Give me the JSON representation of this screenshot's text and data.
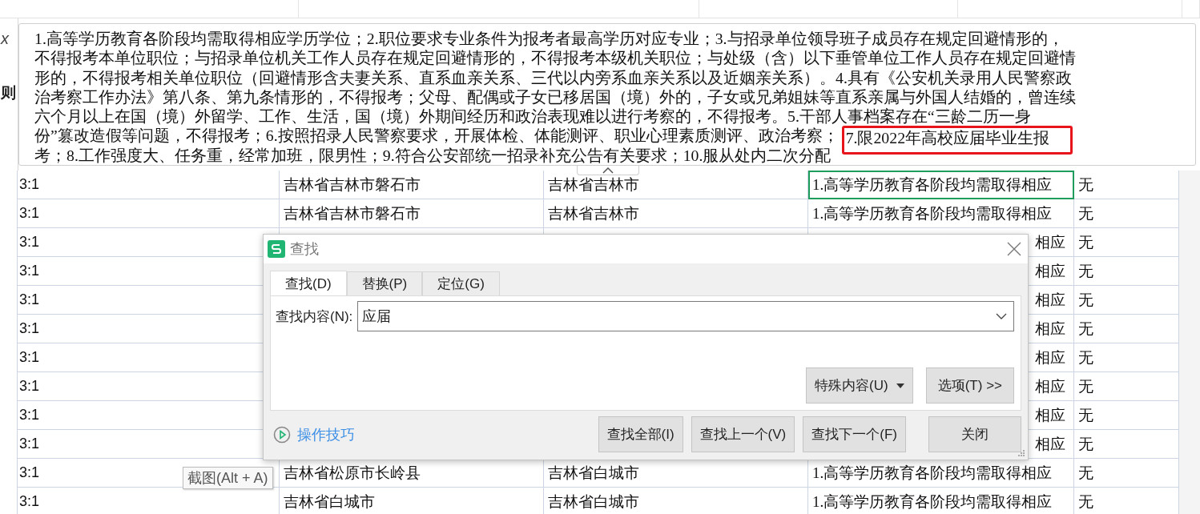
{
  "formula_bar": {
    "fx_fragment": "x",
    "header_fragment": "则",
    "lines": [
      {
        "text": "1.高等学历教育各阶段均需取得相应学历学位；2.职位要求专业条件为报考者最高学历对应专业；3.与招录单位领导班子成员存在规定回避情形的，"
      },
      {
        "text": "不得报考本单位职位；与招录单位机关工作人员存在规定回避情形的，不得报考本级机关职位；与处级（含）以下垂管单位工作人员存在规定回避情"
      },
      {
        "text": "形的，不得报考相关单位职位（回避情形含夫妻关系、直系血亲关系、三代以内旁系血亲关系以及近姻亲关系）。4.具有《公安机关录用人民警察政"
      },
      {
        "text": "治考察工作办法》第八条、第九条情形的，不得报考；父母、配偶或子女已移居国（境）外的，子女或兄弟姐妹等直系亲属与外国人结婚的，曾连续"
      },
      {
        "text": "六个月以上在国（境）外留学、工作、生活，国（境）外期间经历和政治表现难以进行考察的，不得报考。5.干部人事档案存在“三龄二历一身"
      },
      {
        "text": "份”篡改造假等问题，不得报考；6.按照招录人民警察要求，开展体检、体能测评、职业心理素质测评、政治考察；",
        "highlight": "7.限2022年高校应届毕业生报"
      },
      {
        "text": "考；8.工作强度大、任务重，经常加班，限男性；9.符合公安部统一招录补充公告有关要求；10.服从处内二次分配"
      }
    ]
  },
  "rows": [
    {
      "ratio": "3:1",
      "place": "吉林省吉林市磐石市",
      "city": "吉林省吉林市",
      "requirement": "1.高等学历教育各阶段均需取得相应",
      "other": "无",
      "selected": true,
      "covered": false
    },
    {
      "ratio": "3:1",
      "place": "吉林省吉林市磐石市",
      "city": "吉林省吉林市",
      "requirement": "1.高等学历教育各阶段均需取得相应",
      "other": "无",
      "selected": false,
      "covered": false
    },
    {
      "ratio": "3:1",
      "requirement": "相应",
      "other": "无",
      "selected": false,
      "covered": true
    },
    {
      "ratio": "3:1",
      "requirement": "相应",
      "other": "无",
      "selected": false,
      "covered": true
    },
    {
      "ratio": "3:1",
      "requirement": "相应",
      "other": "无",
      "selected": false,
      "covered": true
    },
    {
      "ratio": "3:1",
      "requirement": "相应",
      "other": "无",
      "selected": false,
      "covered": true
    },
    {
      "ratio": "3:1",
      "requirement": "相应",
      "other": "无",
      "selected": false,
      "covered": true
    },
    {
      "ratio": "3:1",
      "requirement": "相应",
      "other": "无",
      "selected": false,
      "covered": true
    },
    {
      "ratio": "3:1",
      "requirement": "相应",
      "other": "无",
      "selected": false,
      "covered": true
    },
    {
      "ratio": "3:1",
      "requirement": "相应",
      "other": "无",
      "selected": false,
      "covered": true
    },
    {
      "ratio": "3:1",
      "place": "吉林省松原市长岭县",
      "city": "吉林省白城市",
      "requirement": "1.高等学历教育各阶段均需取得相应",
      "other": "无",
      "selected": false,
      "covered": false
    },
    {
      "ratio": "3:1",
      "place": "吉林省白城市",
      "city": "吉林省白城市",
      "requirement": "1.高等学历教育各阶段均需取得相应",
      "other": "无",
      "selected": false,
      "covered": false
    }
  ],
  "tooltip": "截图(Alt + A)",
  "dialog": {
    "title": "查找",
    "tabs": [
      {
        "label": "查找(D)",
        "selected": true
      },
      {
        "label": "替换(P)",
        "selected": false
      },
      {
        "label": "定位(G)",
        "selected": false
      }
    ],
    "find_label": "查找内容(N):",
    "find_value": "应届",
    "special_button": "特殊内容(U)",
    "options_button": "选项(T) >>",
    "tips_link": "操作技巧",
    "buttons": [
      "查找全部(I)",
      "查找上一个(V)",
      "查找下一个(F)",
      "关闭"
    ]
  }
}
